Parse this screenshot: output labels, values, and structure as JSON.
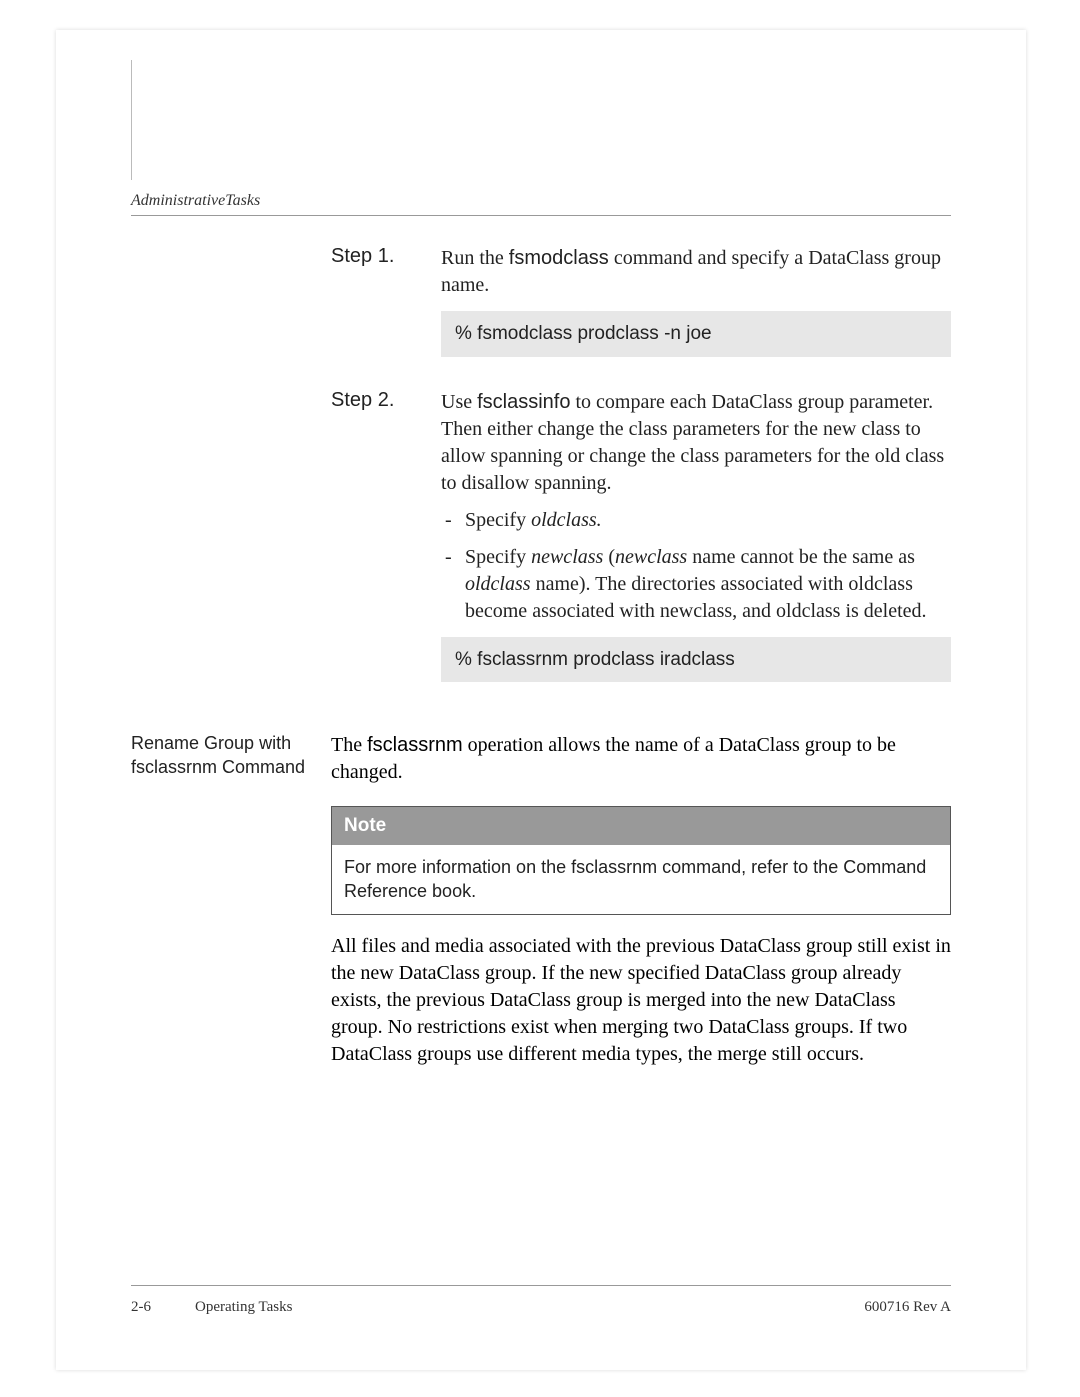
{
  "header": {
    "running": "AdministrativeTasks"
  },
  "steps": {
    "step1": {
      "label": "Step 1.",
      "text_prefix": "Run the ",
      "cmd": "fsmodclass",
      "text_suffix": " command and specify a DataClass group name.",
      "code": "% fsmodclass    prodclass -n   joe"
    },
    "step2": {
      "label": "Step 2.",
      "text_prefix": "Use ",
      "cmd": "fsclassinfo",
      "text_suffix": " to compare each DataClass group parameter. Then either change the class parameters for the new class to allow spanning or change the class parameters for the old class to disallow spanning.",
      "bullet1_pre": "Specify ",
      "bullet1_it": "oldclass.",
      "bullet2_a": "Specify ",
      "bullet2_it1": "newclass",
      "bullet2_b": " (",
      "bullet2_it2": "newclass",
      "bullet2_c": " name cannot be the same as ",
      "bullet2_it3": "oldclass",
      "bullet2_d": " name). The directories associated with oldclass become associated with newclass, and oldclass is deleted.",
      "code": "% fsclassrnm    prodclass  iradclass"
    }
  },
  "section": {
    "side_label": "Rename Group with fsclassrnm Command",
    "intro_a": "The ",
    "intro_cmd": "fsclassrnm",
    "intro_b": " operation allows the name of a DataClass group to be changed.",
    "note_header": "Note",
    "note_a": "For more information on the ",
    "note_cmd": "fsclassrnm",
    "note_b": " command, refer to the Command Reference book.",
    "para": "All files and media associated with the previous DataClass group still exist in the new DataClass group. If the new specified DataClass group already exists, the previous DataClass group is merged into the new DataClass group. No restrictions exist when merging two DataClass groups. If two DataClass groups use different media types, the merge still occurs."
  },
  "footer": {
    "page": "2-6",
    "title": "Operating Tasks",
    "rev": "600716 Rev A"
  }
}
